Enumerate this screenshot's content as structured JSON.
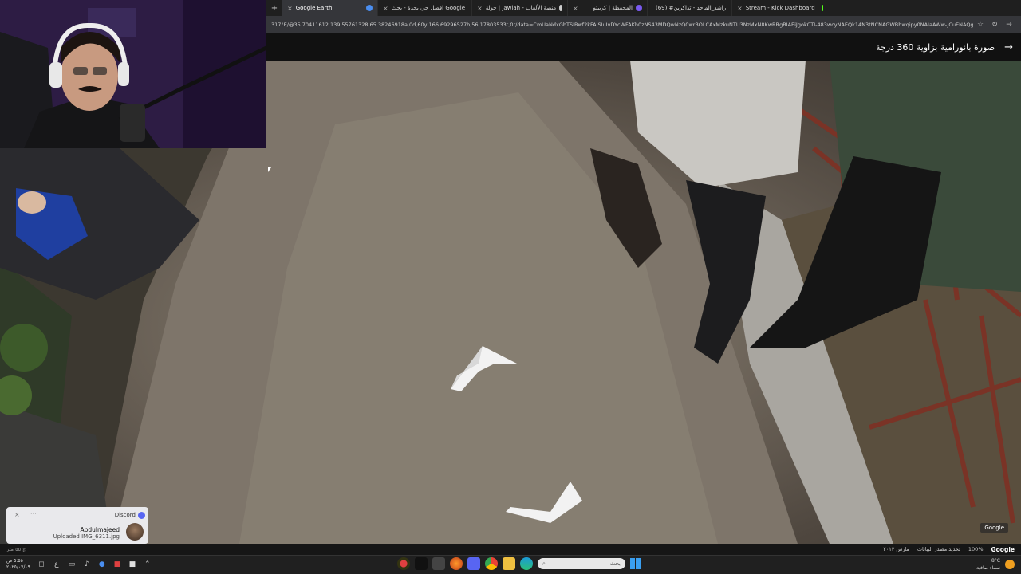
{
  "browser": {
    "tabs": [
      {
        "label": "Stream - Kick Dashboard",
        "active": false
      },
      {
        "label": "(69) #راشد_الماجد - تذاكرين",
        "active": false
      },
      {
        "label": "المحفظة | كريبتو",
        "active": false
      },
      {
        "label": "جولة | Jawlah - منصة الألعاب",
        "active": false
      },
      {
        "label": "افضل حي بجدة - بحث Google",
        "active": false
      },
      {
        "label": "Google Earth",
        "active": true
      }
    ],
    "new_tab_symbol": "+",
    "close_symbol": "×",
    "url": "317°E/@35.70411612,139.55761328,65.38246918a,0d,60y,166.69296527h,56.17803533t,0r/data=CmUaNdxGbTSIBwf2kFAISIuIvDYcWFAKh0zNS43MDQwNzQ0wrBOLCAxMzkuNTU3NzMxN8KwRRgBIAEiJgokCTI-483wcyNAEQk14N3tNCNAGWBhwqipy0NAIaAWw-JCuENAQgIIASIaCh"
  },
  "panorama": {
    "title": "صورة بانورامية بزاوية 360 درجة",
    "back_icon": "arrow-right-icon"
  },
  "notification": {
    "app": "Discord",
    "sender": "Abdulmajeed",
    "message": "Uploaded IMG_6311.jpg"
  },
  "mapbar": {
    "left_text": "چ ٥٥ متر",
    "date": "مارس ٢٠١٣",
    "source": "تحديد مصدر البيانات",
    "zoom": "100%",
    "logo": "Google"
  },
  "google_tag": "Google",
  "taskbar": {
    "clock_time": "٥:٥٥ ص",
    "clock_date": "٢٠٢٥/٠٧/٠٩",
    "keyboard": "ع",
    "search_placeholder": "بحث",
    "weather_temp": "8°C",
    "weather_desc": "سماء صافية"
  }
}
